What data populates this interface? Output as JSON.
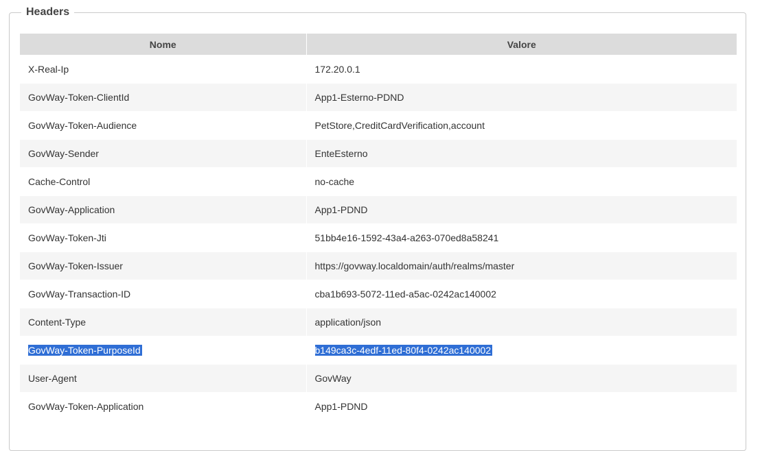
{
  "section": {
    "title": "Headers"
  },
  "table": {
    "columns": [
      "Nome",
      "Valore"
    ],
    "rows": [
      {
        "name": "X-Real-Ip",
        "value": "172.20.0.1"
      },
      {
        "name": "GovWay-Token-ClientId",
        "value": "App1-Esterno-PDND"
      },
      {
        "name": "GovWay-Token-Audience",
        "value": "PetStore,CreditCardVerification,account"
      },
      {
        "name": "GovWay-Sender",
        "value": "EnteEsterno"
      },
      {
        "name": "Cache-Control",
        "value": "no-cache"
      },
      {
        "name": "GovWay-Application",
        "value": "App1-PDND"
      },
      {
        "name": "GovWay-Token-Jti",
        "value": "51bb4e16-1592-43a4-a263-070ed8a58241"
      },
      {
        "name": "GovWay-Token-Issuer",
        "value": "https://govway.localdomain/auth/realms/master"
      },
      {
        "name": "GovWay-Transaction-ID",
        "value": "cba1b693-5072-11ed-a5ac-0242ac140002"
      },
      {
        "name": "Content-Type",
        "value": "application/json"
      },
      {
        "name": "GovWay-Token-PurposeId",
        "value": "b149ca3c-4edf-11ed-80f4-0242ac140002"
      },
      {
        "name": "User-Agent",
        "value": "GovWay"
      },
      {
        "name": "GovWay-Token-Application",
        "value": "App1-PDND"
      }
    ]
  },
  "selection": {
    "color": "#2f6ed5"
  }
}
